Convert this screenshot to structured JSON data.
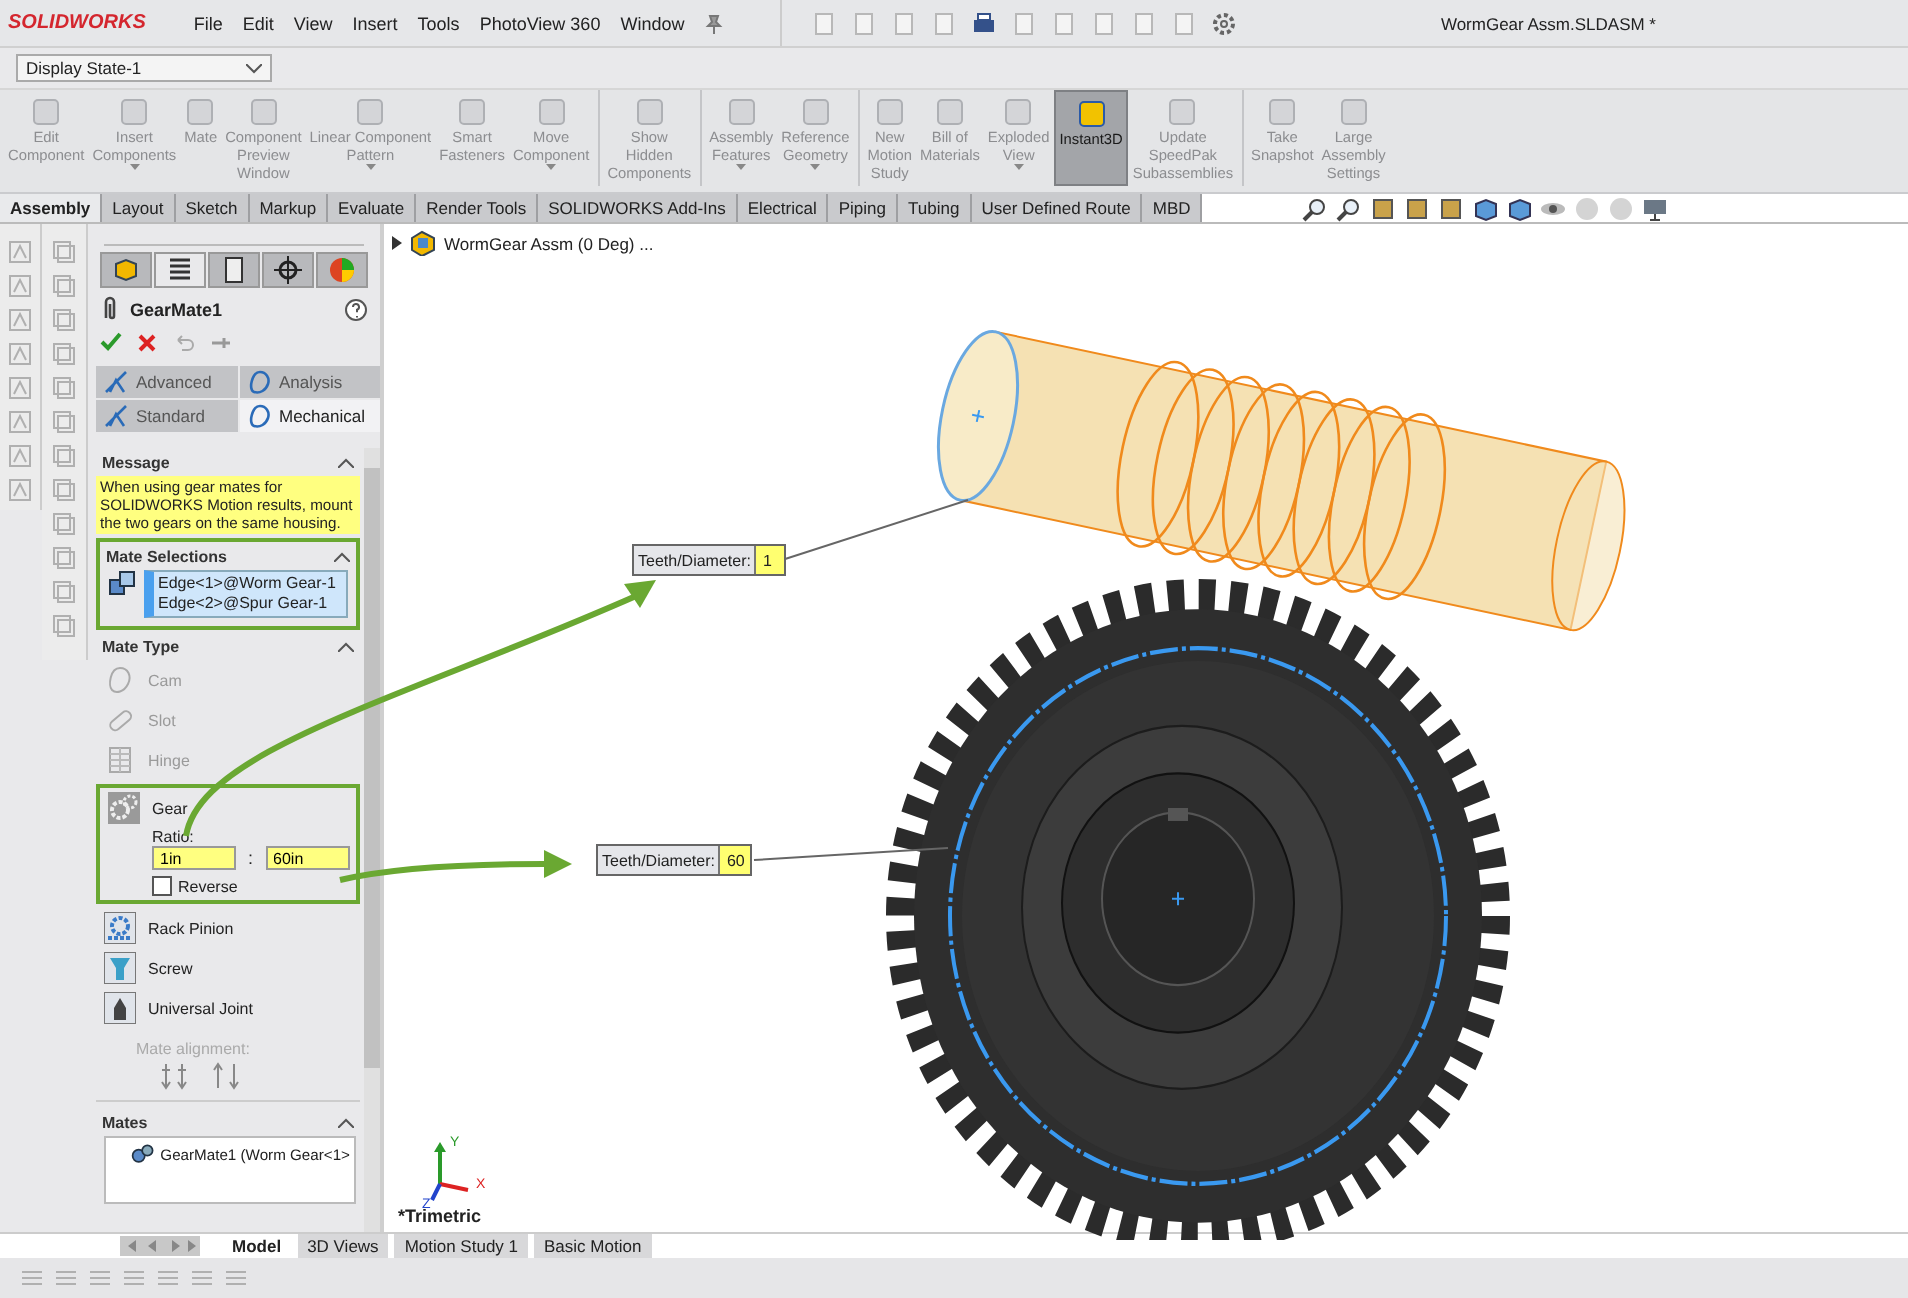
{
  "app": {
    "logo": "SOLIDWORKS",
    "menu": [
      "File",
      "Edit",
      "View",
      "Insert",
      "Tools",
      "PhotoView 360",
      "Window"
    ],
    "document_title": "WormGear Assm.SLDASM *"
  },
  "display_state": {
    "value": "Display State-1"
  },
  "ribbon": [
    {
      "label": "Edit\nComponent",
      "dropdown": false,
      "separator_before": false,
      "selected": false
    },
    {
      "label": "Insert\nComponents",
      "dropdown": true,
      "separator_before": false,
      "selected": false
    },
    {
      "label": "Mate",
      "dropdown": false,
      "separator_before": false,
      "selected": false
    },
    {
      "label": "Component\nPreview\nWindow",
      "dropdown": false,
      "separator_before": false,
      "selected": false
    },
    {
      "label": "Linear Component\nPattern",
      "dropdown": true,
      "separator_before": false,
      "selected": false
    },
    {
      "label": "Smart\nFasteners",
      "dropdown": false,
      "separator_before": false,
      "selected": false
    },
    {
      "label": "Move\nComponent",
      "dropdown": true,
      "separator_before": false,
      "selected": false
    },
    {
      "label": "Show\nHidden\nComponents",
      "dropdown": false,
      "separator_before": true,
      "selected": false
    },
    {
      "label": "Assembly\nFeatures",
      "dropdown": true,
      "separator_before": true,
      "selected": false
    },
    {
      "label": "Reference\nGeometry",
      "dropdown": true,
      "separator_before": false,
      "selected": false
    },
    {
      "label": "New\nMotion\nStudy",
      "dropdown": false,
      "separator_before": true,
      "selected": false
    },
    {
      "label": "Bill of\nMaterials",
      "dropdown": false,
      "separator_before": false,
      "selected": false
    },
    {
      "label": "Exploded\nView",
      "dropdown": true,
      "separator_before": false,
      "selected": false
    },
    {
      "label": "Instant3D",
      "dropdown": false,
      "separator_before": false,
      "selected": true
    },
    {
      "label": "Update\nSpeedPak\nSubassemblies",
      "dropdown": false,
      "separator_before": false,
      "selected": false
    },
    {
      "label": "Take\nSnapshot",
      "dropdown": false,
      "separator_before": true,
      "selected": false
    },
    {
      "label": "Large\nAssembly\nSettings",
      "dropdown": false,
      "separator_before": false,
      "selected": false
    }
  ],
  "command_tabs": [
    {
      "label": "Assembly",
      "selected": true
    },
    {
      "label": "Layout",
      "selected": false
    },
    {
      "label": "Sketch",
      "selected": false
    },
    {
      "label": "Markup",
      "selected": false
    },
    {
      "label": "Evaluate",
      "selected": false
    },
    {
      "label": "Render Tools",
      "selected": false
    },
    {
      "label": "SOLIDWORKS Add-Ins",
      "selected": false
    },
    {
      "label": "Electrical",
      "selected": false
    },
    {
      "label": "Piping",
      "selected": false
    },
    {
      "label": "Tubing",
      "selected": false
    },
    {
      "label": "User Defined Route",
      "selected": false
    },
    {
      "label": "MBD",
      "selected": false
    }
  ],
  "property_manager": {
    "panel_tabs": [
      {
        "selected": false
      },
      {
        "selected": true
      },
      {
        "selected": false
      },
      {
        "selected": false
      },
      {
        "selected": false
      }
    ],
    "title": "GearMate1",
    "mode_tabs": [
      {
        "label": "Advanced",
        "selected": false
      },
      {
        "label": "Analysis",
        "selected": false
      },
      {
        "label": "Standard",
        "selected": false
      },
      {
        "label": "Mechanical",
        "selected": true
      }
    ],
    "message": {
      "title": "Message",
      "text": "When using gear mates for SOLIDWORKS Motion results, mount the two gears on the same housing."
    },
    "mate_selections": {
      "title": "Mate Selections",
      "items": [
        "Edge<1>@Worm Gear-1",
        "Edge<2>@Spur Gear-1"
      ]
    },
    "mate_type": {
      "title": "Mate Type",
      "items": [
        {
          "label": "Cam",
          "kind": "cam",
          "disabled": true,
          "selected": false
        },
        {
          "label": "Slot",
          "kind": "slot",
          "disabled": true,
          "selected": false
        },
        {
          "label": "Hinge",
          "kind": "hinge",
          "disabled": true,
          "selected": false
        },
        {
          "label": "Gear",
          "kind": "gear",
          "disabled": false,
          "selected": true
        },
        {
          "label": "Rack Pinion",
          "kind": "rack",
          "disabled": false,
          "selected": false
        },
        {
          "label": "Screw",
          "kind": "screw",
          "disabled": false,
          "selected": false
        },
        {
          "label": "Universal Joint",
          "kind": "joint",
          "disabled": false,
          "selected": false
        }
      ],
      "ratio": {
        "label": "Ratio:",
        "value_1": "1in",
        "separator": ":",
        "value_2": "60in"
      },
      "reverse": {
        "label": "Reverse",
        "checked": false
      },
      "mate_alignment": "Mate alignment:"
    },
    "mates": {
      "title": "Mates",
      "items": [
        "GearMate1 (Worm Gear<1>"
      ]
    }
  },
  "tree": {
    "label": "WormGear Assm (0 Deg) ..."
  },
  "callouts": [
    {
      "label": "Teeth/Diameter:",
      "value": "1"
    },
    {
      "label": "Teeth/Diameter:",
      "value": "60"
    }
  ],
  "triad": {
    "axes": [
      "Y",
      "X",
      "Z"
    ]
  },
  "view_label": "*Trimetric",
  "bottom_tabs": [
    {
      "label": "Model",
      "selected": true
    },
    {
      "label": "3D Views",
      "selected": false
    },
    {
      "label": "Motion Study 1",
      "selected": false
    },
    {
      "label": "Basic Motion",
      "selected": false
    }
  ]
}
